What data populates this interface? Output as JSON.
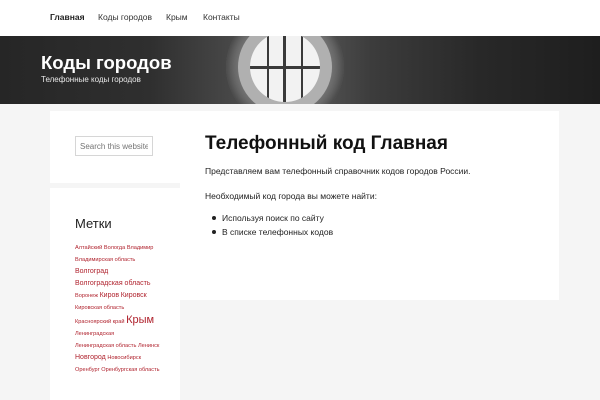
{
  "nav": {
    "items": [
      {
        "label": "Главная"
      },
      {
        "label": "Коды городов"
      },
      {
        "label": "Крым"
      },
      {
        "label": "Контакты"
      }
    ]
  },
  "header": {
    "site_title": "Коды городов",
    "tagline": "Телефонные коды городов"
  },
  "sidebar": {
    "search_placeholder": "Search this website",
    "tags_title": "Метки",
    "tags": [
      {
        "label": "Алтайский",
        "size": "s"
      },
      {
        "label": "Вологда",
        "size": "s"
      },
      {
        "label": "Владимир",
        "size": "s"
      },
      {
        "label": "Владимирская область",
        "size": "s"
      },
      {
        "label": "Волгоград",
        "size": "m"
      },
      {
        "label": "Волгоградская область",
        "size": "m"
      },
      {
        "label": "Воронеж",
        "size": "s"
      },
      {
        "label": "Киров",
        "size": "m"
      },
      {
        "label": "Кировск",
        "size": "m"
      },
      {
        "label": "Кировская область",
        "size": "s"
      },
      {
        "label": "Красноярский край",
        "size": "s"
      },
      {
        "label": "Крым",
        "size": "l"
      },
      {
        "label": "Ленинградская",
        "size": "s"
      },
      {
        "label": "Ленинградская область",
        "size": "s"
      },
      {
        "label": "Ленинск",
        "size": "s"
      },
      {
        "label": "Новгород",
        "size": "m"
      },
      {
        "label": "Новосибирск",
        "size": "s"
      },
      {
        "label": "Оренбург",
        "size": "s"
      },
      {
        "label": "Оренбургская область",
        "size": "s"
      }
    ]
  },
  "content": {
    "title": "Телефонный код Главная",
    "intro": "Представляем вам телефонный справочник кодов городов России.",
    "lead": "Необходимый код города вы можете найти:",
    "list": [
      "Используя поиск по сайту",
      "В списке телефонных кодов"
    ]
  },
  "colors": {
    "tag_link": "#b0232e",
    "hero_background": "#2a2a2a",
    "page_background": "#f5f5f5"
  }
}
